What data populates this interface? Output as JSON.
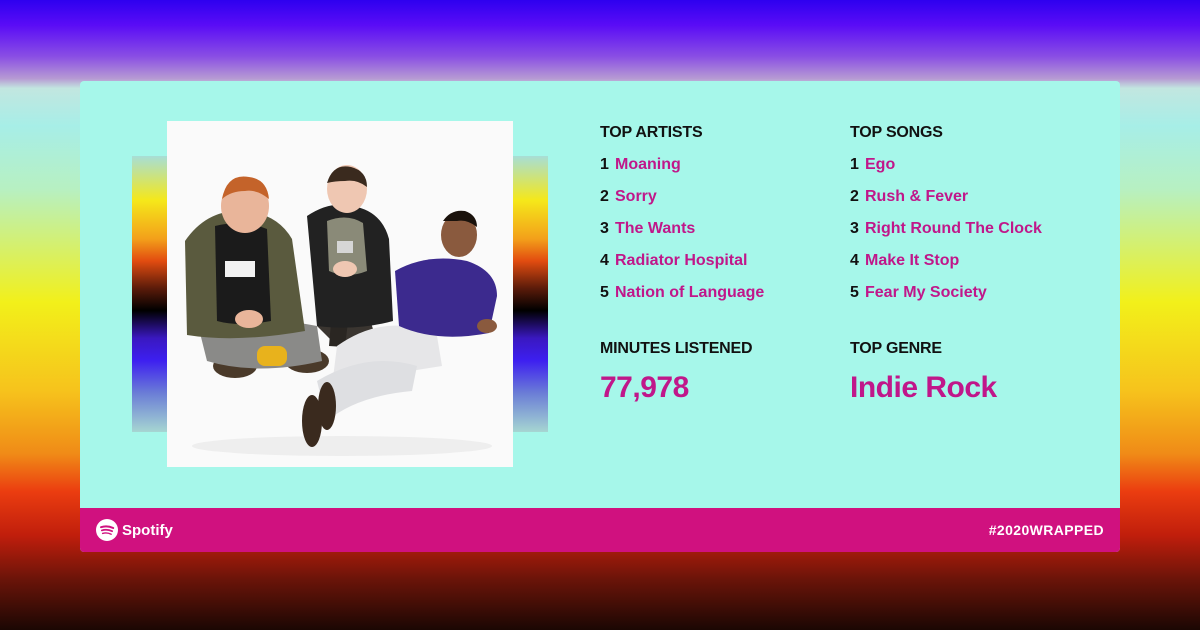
{
  "top_artists": {
    "title": "TOP ARTISTS",
    "items": [
      {
        "rank": "1",
        "name": "Moaning"
      },
      {
        "rank": "2",
        "name": "Sorry"
      },
      {
        "rank": "3",
        "name": "The Wants"
      },
      {
        "rank": "4",
        "name": "Radiator Hospital"
      },
      {
        "rank": "5",
        "name": "Nation of Language"
      }
    ]
  },
  "top_songs": {
    "title": "TOP SONGS",
    "items": [
      {
        "rank": "1",
        "name": "Ego"
      },
      {
        "rank": "2",
        "name": "Rush & Fever"
      },
      {
        "rank": "3",
        "name": "Right Round The Clock"
      },
      {
        "rank": "4",
        "name": "Make It Stop"
      },
      {
        "rank": "5",
        "name": "Fear My Society"
      }
    ]
  },
  "minutes": {
    "title": "MINUTES LISTENED",
    "value": "77,978"
  },
  "genre": {
    "title": "TOP GENRE",
    "value": "Indie Rock"
  },
  "footer": {
    "brand": "Spotify",
    "brand_icon": "spotify-logo-icon",
    "hashtag": "#2020WRAPPED"
  },
  "colors": {
    "card_background": "#a6f7ea",
    "accent": "#c0178a",
    "footer_background": "#d0117f"
  }
}
